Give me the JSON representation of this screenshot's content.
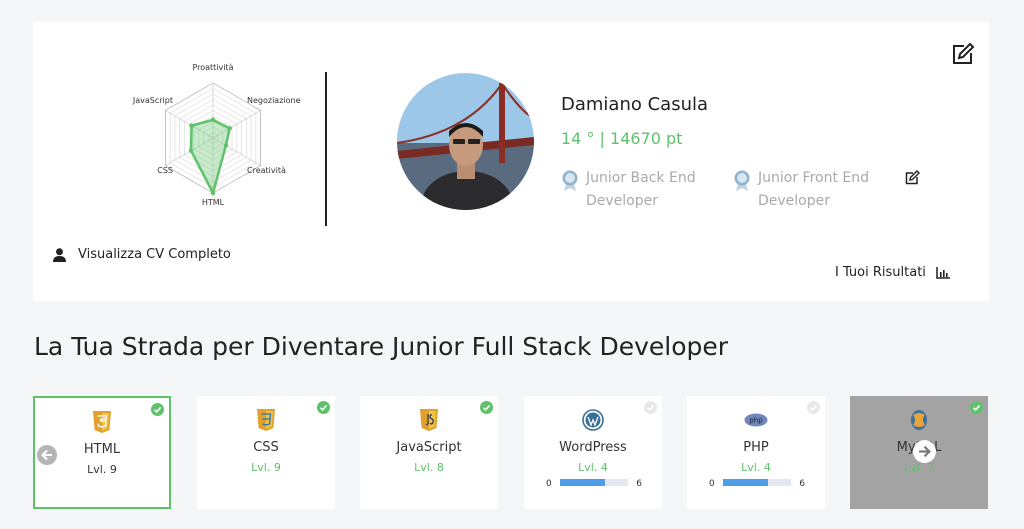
{
  "profile": {
    "name": "Damiano Casula",
    "score": "14 ° | 14670 pt",
    "badges": [
      {
        "label": "Junior Back End Developer"
      },
      {
        "label": "Junior Front End Developer"
      }
    ],
    "cv_link": "Visualizza CV Completo",
    "results_link": "I Tuoi Risultati"
  },
  "chart_data": {
    "type": "radar",
    "axes": [
      "Proattività",
      "Negoziazione",
      "Creatività",
      "HTML",
      "CSS",
      "JavaScript"
    ],
    "values": [
      0.33,
      0.35,
      0.27,
      1.0,
      0.46,
      0.45
    ],
    "max": 1,
    "grid_levels": 10,
    "color": "#5ec26a"
  },
  "roadmap": {
    "title": "La Tua Strada per Diventare Junior Full Stack Developer",
    "skills": [
      {
        "name": "HTML",
        "level": "Lvl. 9",
        "icon": "html5-icon",
        "done": true
      },
      {
        "name": "CSS",
        "level": "Lvl. 9",
        "icon": "css3-icon",
        "done": true
      },
      {
        "name": "JavaScript",
        "level": "Lvl. 8",
        "icon": "js-icon",
        "done": true
      },
      {
        "name": "WordPress",
        "level": "Lvl. 4",
        "icon": "wordpress-icon",
        "done": false,
        "progress": {
          "min": "0",
          "max": "6",
          "value": 4
        }
      },
      {
        "name": "PHP",
        "level": "Lvl. 4",
        "icon": "php-icon",
        "done": false,
        "progress": {
          "min": "0",
          "max": "6",
          "value": 4
        }
      },
      {
        "name": "MySQL",
        "level": "Lvl. 7",
        "icon": "mysql-icon",
        "done": true
      }
    ]
  },
  "colors": {
    "accent": "#5ec26a",
    "progress": "#4f9ee8",
    "background": "#f5f6f8"
  }
}
